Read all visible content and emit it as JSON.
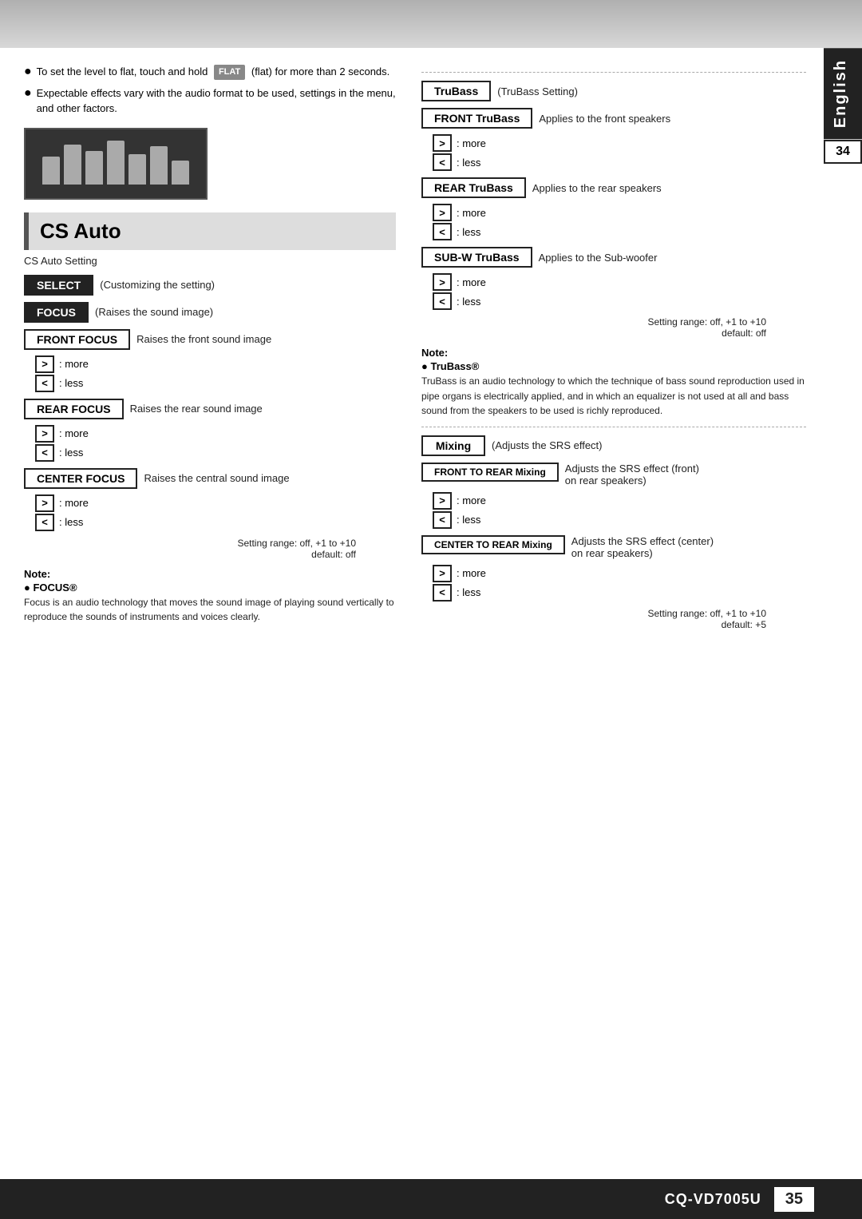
{
  "top": {
    "english_label": "English",
    "page_number": "34"
  },
  "bottom": {
    "model": "CQ-VD7005U",
    "page_num": "35"
  },
  "left": {
    "bullet1": "To set the level to flat, touch and hold",
    "flat_label": "FLAT",
    "bullet1_end": "(flat) for more than 2 seconds.",
    "bullet2": "Expectable effects vary with the audio format to be used, settings in the menu, and other factors.",
    "cs_auto_heading": "CS Auto",
    "cs_auto_subtitle": "CS Auto Setting",
    "select_label": "SELECT",
    "select_desc": "(Customizing the setting)",
    "focus_label": "FOCUS",
    "focus_desc": "(Raises the sound image)",
    "front_focus_label": "FRONT FOCUS",
    "front_focus_desc": "Raises the front sound image",
    "more_label": ": more",
    "less_label": ": less",
    "rear_focus_label": "REAR FOCUS",
    "rear_focus_desc": "Raises the rear sound image",
    "center_focus_label": "CENTER FOCUS",
    "center_focus_desc": "Raises the central sound image",
    "setting_range": "Setting range: off, +1 to +10",
    "default_off": "default: off",
    "note_title": "Note:",
    "focus_note_bullet": "● FOCUS®",
    "focus_note_text": "Focus is an audio technology that moves the sound image of playing sound vertically to reproduce the sounds of instruments and voices clearly."
  },
  "right": {
    "trubass_label": "TruBass",
    "trubass_desc": "(TruBass Setting)",
    "front_trubass_label": "FRONT TruBass",
    "front_trubass_desc": "Applies to the front speakers",
    "more_label": ": more",
    "less_label": ": less",
    "rear_trubass_label": "REAR TruBass",
    "rear_trubass_desc": "Applies to the rear speakers",
    "subw_trubass_label": "SUB-W TruBass",
    "subw_trubass_desc": "Applies to the Sub-woofer",
    "setting_range": "Setting range: off, +1 to +10",
    "default_off": "default: off",
    "note_title": "Note:",
    "trubass_note_bullet": "● TruBass®",
    "trubass_note_text": "TruBass is an audio technology to which the technique of bass sound reproduction used in pipe organs is electrically applied, and in which an equalizer is not used at all and bass sound from the speakers to be used is richly reproduced.",
    "mixing_label": "Mixing",
    "mixing_desc": "(Adjusts the SRS effect)",
    "front_to_rear_label": "FRONT TO REAR Mixing",
    "front_to_rear_desc1": "Adjusts the SRS effect (front)",
    "front_to_rear_desc2": "on rear speakers)",
    "center_to_rear_label": "CENTER TO REAR Mixing",
    "center_to_rear_desc1": "Adjusts the SRS effect (center)",
    "center_to_rear_desc2": "on rear speakers)",
    "setting_range2": "Setting range: off, +1 to +10",
    "default_5": "default: +5"
  }
}
